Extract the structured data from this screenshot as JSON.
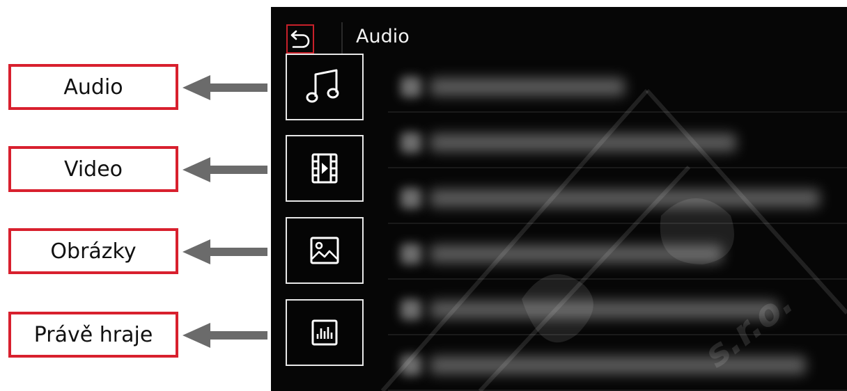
{
  "callouts": [
    {
      "label": "Audio"
    },
    {
      "label": "Video"
    },
    {
      "label": "Obrázky"
    },
    {
      "label": "Právě hraje"
    }
  ],
  "screen": {
    "title": "Audio",
    "back_icon": "back-arrow-icon",
    "side_buttons": [
      {
        "icon": "music-note-icon"
      },
      {
        "icon": "film-strip-icon"
      },
      {
        "icon": "image-icon"
      },
      {
        "icon": "equalizer-icon"
      }
    ],
    "track_list_note": "track titles are blurred in the screenshot",
    "watermark": "s.r.o."
  },
  "colors": {
    "callout_border": "#d8202e",
    "arrow": "#6b6b6b",
    "screen_bg": "#060606",
    "back_highlight": "#c8202a",
    "icon_stroke": "#e8e8e8"
  }
}
